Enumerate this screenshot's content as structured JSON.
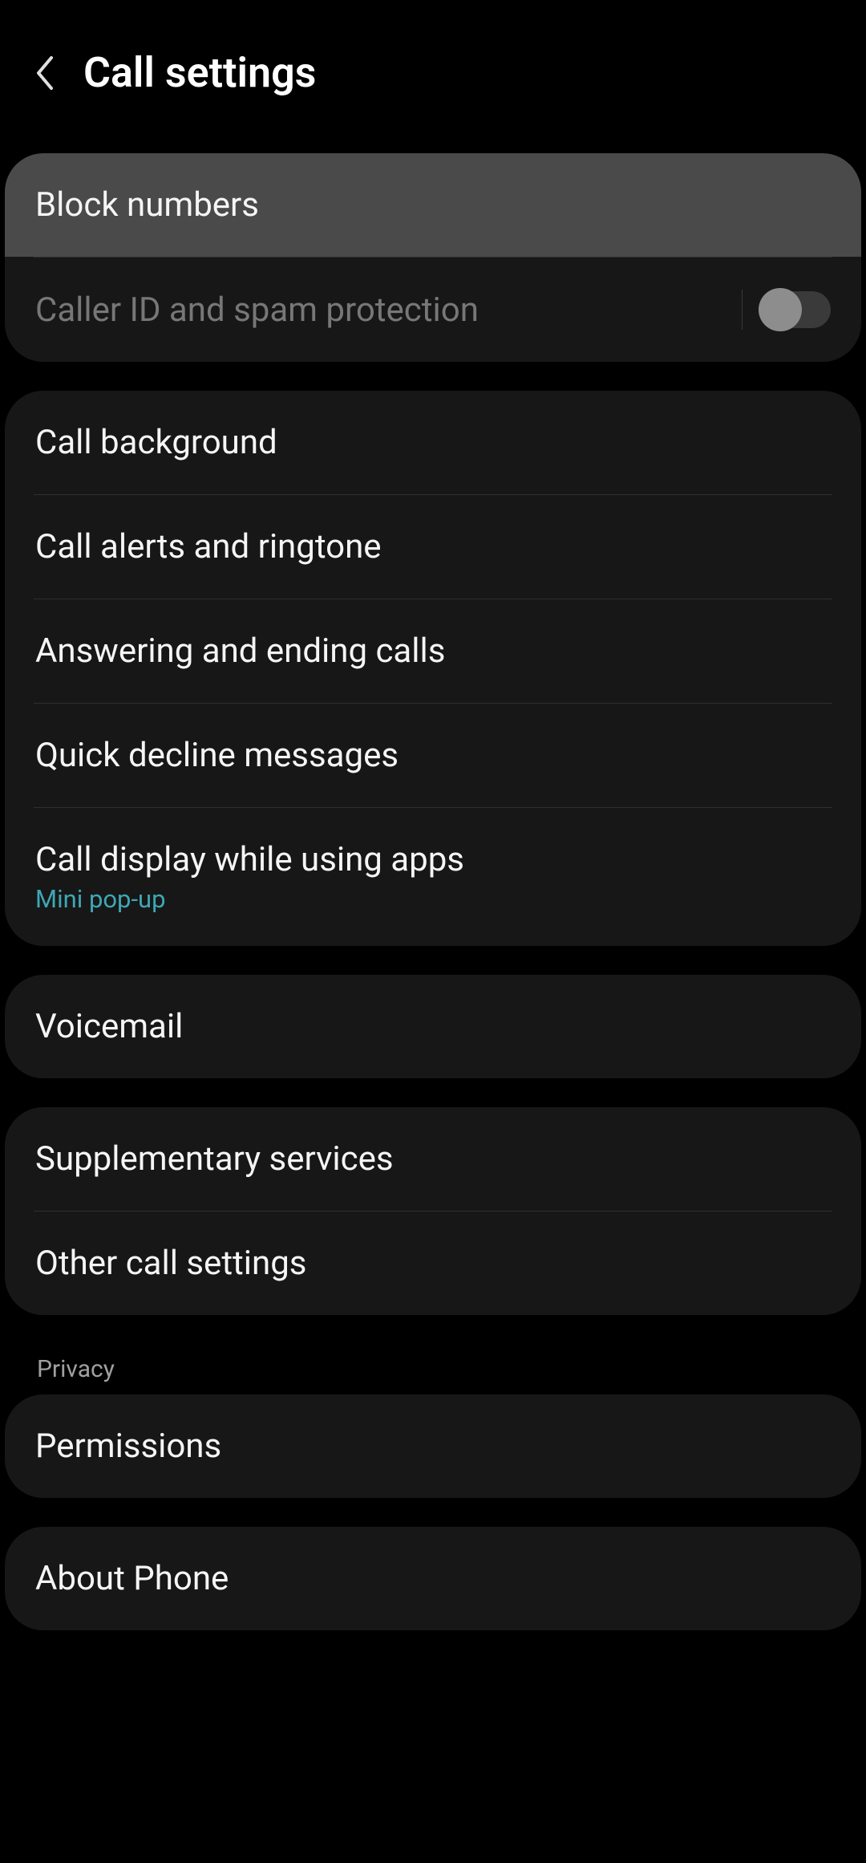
{
  "header": {
    "title": "Call settings"
  },
  "groups": [
    {
      "items": [
        {
          "label": "Block numbers",
          "highlighted": true
        },
        {
          "label": "Caller ID and spam protection",
          "dimmed": true,
          "toggle": true
        }
      ]
    },
    {
      "items": [
        {
          "label": "Call background"
        },
        {
          "label": "Call alerts and ringtone"
        },
        {
          "label": "Answering and ending calls"
        },
        {
          "label": "Quick decline messages"
        },
        {
          "label": "Call display while using apps",
          "sublabel": "Mini pop-up"
        }
      ]
    },
    {
      "items": [
        {
          "label": "Voicemail"
        }
      ]
    },
    {
      "items": [
        {
          "label": "Supplementary services"
        },
        {
          "label": "Other call settings"
        }
      ]
    },
    {
      "sectionHeader": "Privacy",
      "items": [
        {
          "label": "Permissions"
        }
      ]
    },
    {
      "items": [
        {
          "label": "About Phone"
        }
      ]
    }
  ]
}
